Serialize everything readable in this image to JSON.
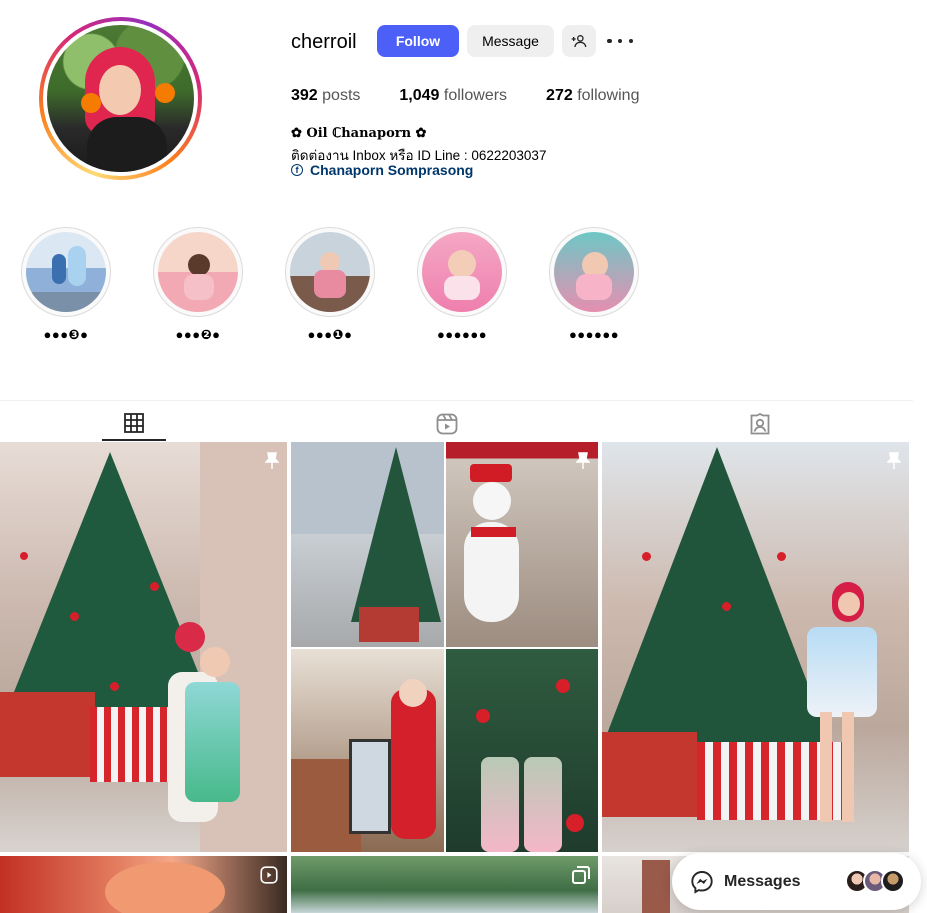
{
  "profile": {
    "username": "cherroil",
    "follow_label": "Follow",
    "message_label": "Message",
    "stats": {
      "posts_count": "392",
      "posts_label": "posts",
      "followers_count": "1,049",
      "followers_label": "followers",
      "following_count": "272",
      "following_label": "following"
    },
    "bio": {
      "display_name": "✿ 𝐎𝐢𝐥 ℂ𝐡𝐚𝐧𝐚𝐩𝐨𝐫𝐧 ✿",
      "line": "ติดต่องาน Inbox หรือ ID Line : 0622203037",
      "link_text": "Chanaporn Somprasong",
      "link_icon": "facebook-icon"
    }
  },
  "highlights": [
    {
      "label": "●●●❸●"
    },
    {
      "label": "●●●❷●"
    },
    {
      "label": "●●●❶●"
    },
    {
      "label": "●●●●●●"
    },
    {
      "label": "●●●●●●"
    }
  ],
  "tabs": [
    {
      "icon": "grid-icon",
      "active": true
    },
    {
      "icon": "reels-icon",
      "active": false
    },
    {
      "icon": "tagged-icon",
      "active": false
    }
  ],
  "posts": [
    {
      "type": "photo",
      "pinned": true,
      "scene": "christmas-tree-mother-child"
    },
    {
      "type": "carousel",
      "pinned": true,
      "scene": "christmas-collage"
    },
    {
      "type": "photo",
      "pinned": true,
      "scene": "christmas-tree-woman"
    },
    {
      "type": "reel",
      "scene": "salmon-sashimi"
    },
    {
      "type": "carousel",
      "scene": "tree-canopy"
    },
    {
      "type": "photo",
      "scene": "statue"
    }
  ],
  "messages": {
    "label": "Messages",
    "icon": "messenger-icon"
  },
  "colors": {
    "follow_button": "#4c5ff7",
    "link": "#00376b",
    "secondary_button": "#efefef"
  }
}
